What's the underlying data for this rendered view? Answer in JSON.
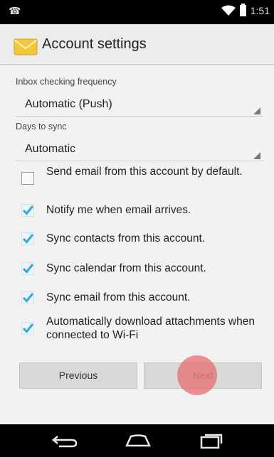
{
  "status_bar": {
    "time": "1:51",
    "left_icon": "call-icon"
  },
  "header": {
    "title": "Account settings",
    "icon": "email-icon"
  },
  "inbox_frequency": {
    "label": "Inbox checking frequency",
    "value": "Automatic (Push)"
  },
  "days_to_sync": {
    "label": "Days to sync",
    "value": "Automatic"
  },
  "options": [
    {
      "label": "Send email from this account by default.",
      "checked": false
    },
    {
      "label": "Notify me when email arrives.",
      "checked": true
    },
    {
      "label": "Sync contacts from this account.",
      "checked": true
    },
    {
      "label": "Sync calendar from this account.",
      "checked": true
    },
    {
      "label": "Sync email from this account.",
      "checked": true
    },
    {
      "label": "Automatically download attachments when connected to Wi-Fi",
      "checked": true
    }
  ],
  "buttons": {
    "previous": "Previous",
    "next": "Next"
  },
  "colors": {
    "checkbox": "#34a7d9",
    "touch": "#e66e6e"
  }
}
